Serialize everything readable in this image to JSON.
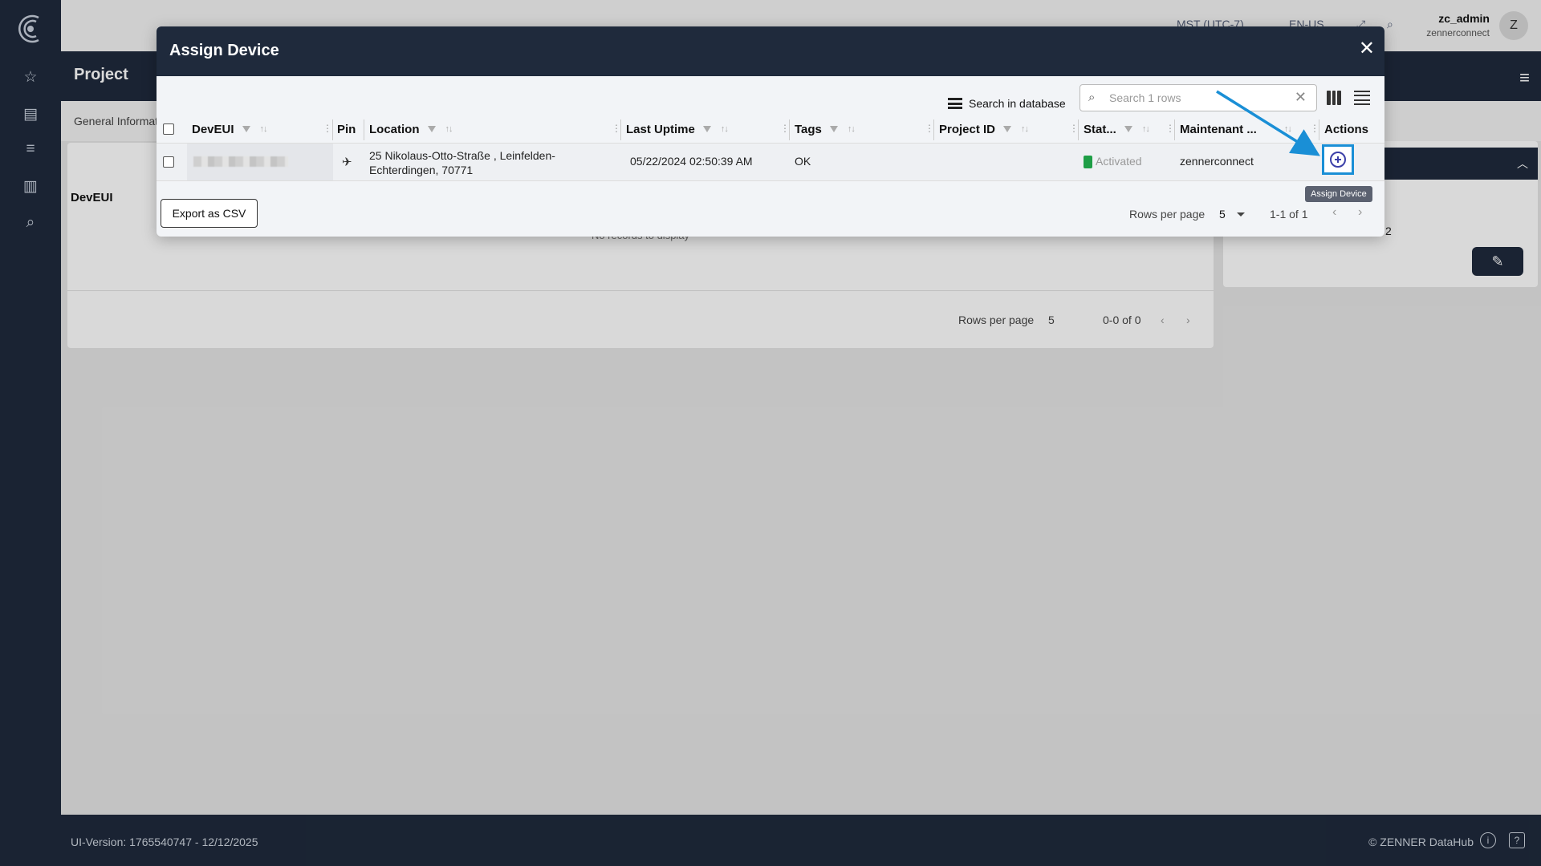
{
  "topbar": {
    "timezone": "MST (UTC-7)",
    "language": "EN-US",
    "username": "zc_admin",
    "org": "zennerconnect",
    "avatar_letter": "Z"
  },
  "project": {
    "title": "Project"
  },
  "background": {
    "tab_label": "General Informat",
    "column_devEUI": "DevEUI",
    "no_records": "No records to display",
    "rows_per_page_label": "Rows per page",
    "rows_per_page_value": "5",
    "pagination": "0-0 of 0",
    "right_value": "2"
  },
  "modal": {
    "title": "Assign Device",
    "close_label": "✕",
    "search_db_label": "Search in database",
    "search_placeholder": "Search 1 rows",
    "columns": {
      "devEUI": "DevEUI",
      "pin": "Pin",
      "location": "Location",
      "last_uptime": "Last Uptime",
      "tags": "Tags",
      "project_id": "Project ID",
      "status": "Stat...",
      "maintenant": "Maintenant ...",
      "actions": "Actions"
    },
    "rows": [
      {
        "location_line1": "25 Nikolaus-Otto-Straße , Leinfelden-",
        "location_line2": "Echterdingen, 70771",
        "last_uptime": "05/22/2024 02:50:39 AM",
        "tags": "OK",
        "project_id": "",
        "status": "Activated",
        "maintenant": "zennerconnect"
      }
    ],
    "tooltip": "Assign Device",
    "export_label": "Export as CSV",
    "rows_per_page_label": "Rows per page",
    "rows_per_page_value": "5",
    "pagination": "1-1 of 1"
  },
  "footer": {
    "version": "UI-Version: 1765540747 - 12/12/2025",
    "copyright": "© ZENNER DataHub"
  },
  "colors": {
    "navy": "#1f2a3c",
    "status_green": "#1e9e46",
    "highlight_blue": "#1a8fd6",
    "action_icon": "#3b3fa8"
  }
}
